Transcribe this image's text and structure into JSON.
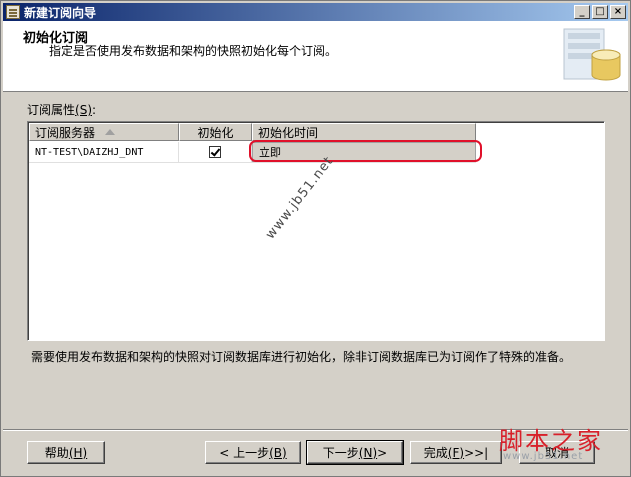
{
  "window": {
    "title": "新建订阅向导",
    "controls": {
      "minimize": "_",
      "maximize": "□",
      "close": "×"
    }
  },
  "header": {
    "title": "初始化订阅",
    "subtitle": "指定是否使用发布数据和架构的快照初始化每个订阅。",
    "graphic": "database-wizard-icon"
  },
  "properties": {
    "label": "订阅属性",
    "mnemonic": "(S)",
    "suffix": ":"
  },
  "grid": {
    "columns": {
      "server": "订阅服务器",
      "init": "初始化",
      "time": "初始化时间"
    },
    "sorted_column": "server",
    "rows": [
      {
        "server": "NT-TEST\\DAIZHJ_DNT",
        "init_checked": true,
        "time": "立即"
      }
    ]
  },
  "watermark": "www.jb51.net",
  "info_text": "需要使用发布数据和架构的快照对订阅数据库进行初始化，除非订阅数据库已为订阅作了特殊的准备。",
  "buttons": {
    "help": {
      "label": "帮助",
      "mnemonic": "(H)"
    },
    "back": {
      "prefix": "< 上一步",
      "mnemonic": "(B)"
    },
    "next": {
      "prefix": "下一步",
      "mnemonic": "(N)",
      "suffix": " >"
    },
    "finish": {
      "label": "完成",
      "mnemonic": "(F)",
      "suffix": " >>|"
    },
    "cancel": {
      "label": "取消"
    }
  },
  "logo": {
    "main": "脚本之家",
    "url": "www.jb51.net"
  },
  "colors": {
    "highlight": "#e0102a",
    "title_bar": "#0a246a",
    "logo": "#d8202a"
  }
}
